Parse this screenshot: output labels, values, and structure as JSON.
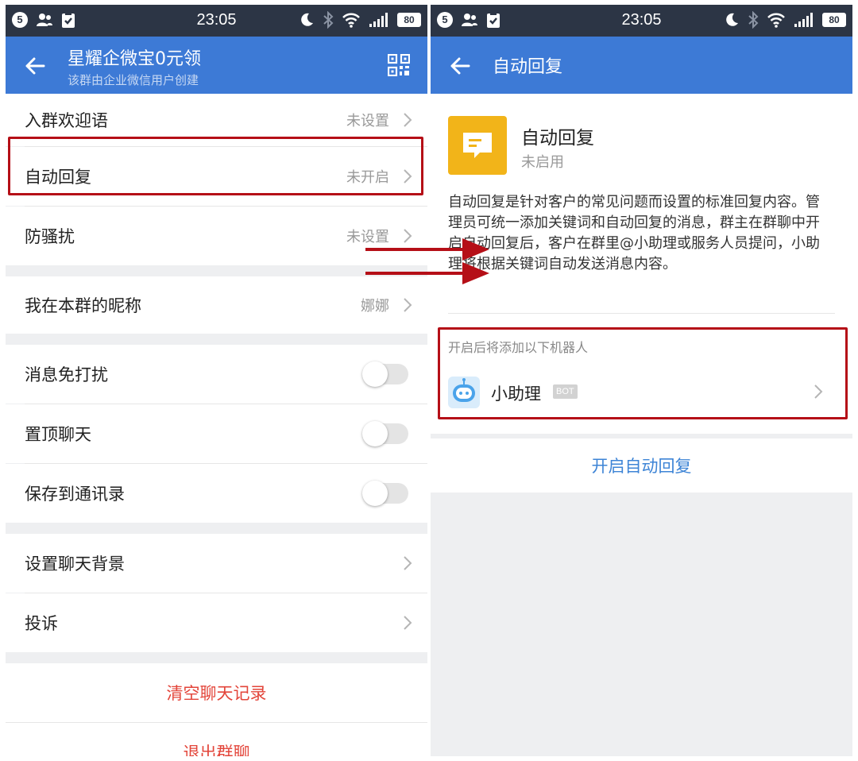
{
  "status_bar": {
    "time": "23:05",
    "notification_count": "5",
    "battery": "80"
  },
  "left_screen": {
    "header": {
      "title": "星耀企微宝0元领",
      "subtitle": "该群由企业微信用户创建"
    },
    "items": [
      {
        "label": "入群欢迎语",
        "value": "未设置"
      },
      {
        "label": "自动回复",
        "value": "未开启"
      },
      {
        "label": "防骚扰",
        "value": "未设置"
      },
      {
        "label": "我在本群的昵称",
        "value": "娜娜"
      },
      {
        "label": "消息免打扰",
        "toggle": false
      },
      {
        "label": "置顶聊天",
        "toggle": false
      },
      {
        "label": "保存到通讯录",
        "toggle": false
      },
      {
        "label": "设置聊天背景"
      },
      {
        "label": "投诉"
      }
    ],
    "actions": {
      "clear_history": "清空聊天记录",
      "exit_group": "退出群聊"
    }
  },
  "right_screen": {
    "header": {
      "title": "自动回复"
    },
    "feature": {
      "name": "自动回复",
      "status": "未启用",
      "description": "自动回复是针对客户的常见问题而设置的标准回复内容。管理员可统一添加关键词和自动回复的消息，群主在群聊中开启自动回复后，客户在群里@小助理或服务人员提问，小助理将根据关键词自动发送消息内容。"
    },
    "robot_section_label": "开启后将添加以下机器人",
    "bot": {
      "name": "小助理",
      "tag": "BOT"
    },
    "enable_button": "开启自动回复"
  },
  "colors": {
    "nav_blue": "#3d7ad6",
    "status_bar": "#2c3545",
    "highlight_red": "#b50f17",
    "danger_red": "#e3453a",
    "link_blue": "#3d84d6",
    "icon_yellow": "#f2b419"
  },
  "icons": {
    "back": "arrow-left-icon",
    "qr": "qr-code-icon",
    "chevron": "chevron-right-icon",
    "feature": "chat-bubble-icon",
    "bot": "robot-icon"
  }
}
